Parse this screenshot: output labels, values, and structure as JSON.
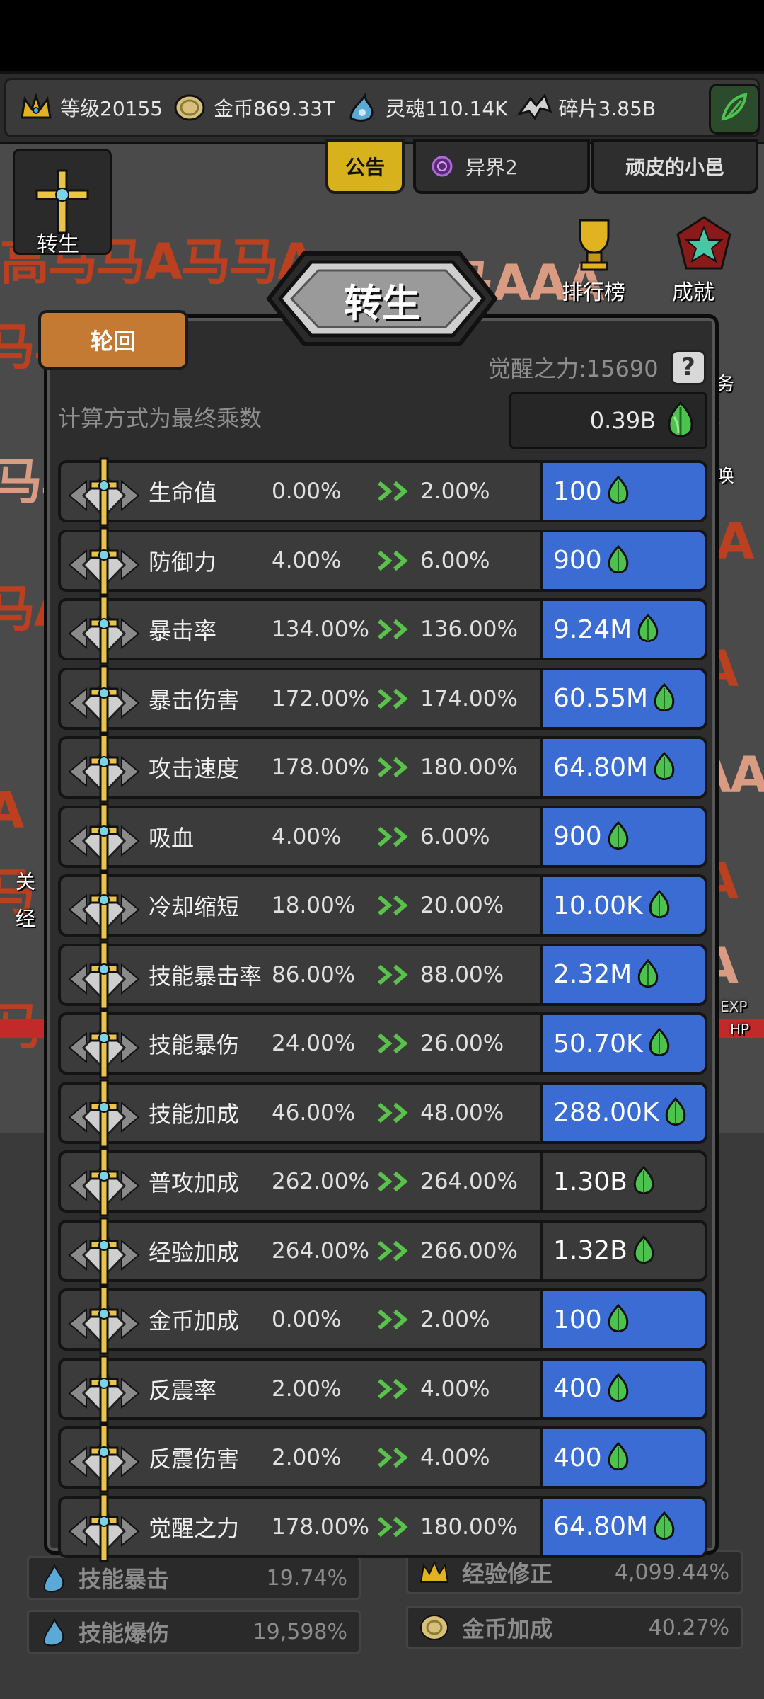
{
  "topbar": {
    "level": "等级20155",
    "gold": "金币869.33T",
    "soul": "灵魂110.14K",
    "fragment": "碎片3.85B"
  },
  "scene": {
    "notice": "公告",
    "realm": "异界2",
    "town": "顽皮的小邑",
    "rebirth_btn": "转生",
    "ranking_btn": "排行榜",
    "achievement_btn": "成就",
    "side_task": "务",
    "side_summon": "唤",
    "side_guan": "关",
    "side_jing": "经",
    "exp": "EXP",
    "hp": "HP"
  },
  "bottom_stats": [
    {
      "name": "技能暴击",
      "value": "19.74%"
    },
    {
      "name": "技能爆伤",
      "value": "19,598%"
    },
    {
      "name": "经验修正",
      "value": "4,099.44%"
    },
    {
      "name": "金币加成",
      "value": "40.27%"
    }
  ],
  "dialog": {
    "title": "转生",
    "tab": "轮回",
    "awaken_power": "觉醒之力:15690",
    "help": "?",
    "calc_note": "计算方式为最终乘数",
    "total": "0.39B",
    "rows": [
      {
        "name": "生命值",
        "cur": "0.00%",
        "next": "2.00%",
        "cost": "100",
        "affordable": true
      },
      {
        "name": "防御力",
        "cur": "4.00%",
        "next": "6.00%",
        "cost": "900",
        "affordable": true
      },
      {
        "name": "暴击率",
        "cur": "134.00%",
        "next": "136.00%",
        "cost": "9.24M",
        "affordable": true
      },
      {
        "name": "暴击伤害",
        "cur": "172.00%",
        "next": "174.00%",
        "cost": "60.55M",
        "affordable": true
      },
      {
        "name": "攻击速度",
        "cur": "178.00%",
        "next": "180.00%",
        "cost": "64.80M",
        "affordable": true
      },
      {
        "name": "吸血",
        "cur": "4.00%",
        "next": "6.00%",
        "cost": "900",
        "affordable": true
      },
      {
        "name": "冷却缩短",
        "cur": "18.00%",
        "next": "20.00%",
        "cost": "10.00K",
        "affordable": true
      },
      {
        "name": "技能暴击率",
        "cur": "86.00%",
        "next": "88.00%",
        "cost": "2.32M",
        "affordable": true
      },
      {
        "name": "技能暴伤",
        "cur": "24.00%",
        "next": "26.00%",
        "cost": "50.70K",
        "affordable": true
      },
      {
        "name": "技能加成",
        "cur": "46.00%",
        "next": "48.00%",
        "cost": "288.00K",
        "affordable": true
      },
      {
        "name": "普攻加成",
        "cur": "262.00%",
        "next": "264.00%",
        "cost": "1.30B",
        "affordable": false
      },
      {
        "name": "经验加成",
        "cur": "264.00%",
        "next": "266.00%",
        "cost": "1.32B",
        "affordable": false
      },
      {
        "name": "金币加成",
        "cur": "0.00%",
        "next": "2.00%",
        "cost": "100",
        "affordable": true
      },
      {
        "name": "反震率",
        "cur": "2.00%",
        "next": "4.00%",
        "cost": "400",
        "affordable": true
      },
      {
        "name": "反震伤害",
        "cur": "2.00%",
        "next": "4.00%",
        "cost": "400",
        "affordable": true
      },
      {
        "name": "觉醒之力",
        "cur": "178.00%",
        "next": "180.00%",
        "cost": "64.80M",
        "affordable": true
      }
    ]
  }
}
